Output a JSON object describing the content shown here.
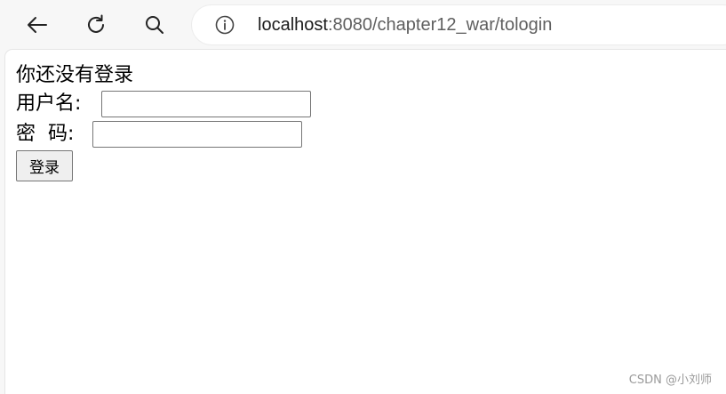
{
  "browser": {
    "url_host": "localhost",
    "url_rest": ":8080/chapter12_war/tologin",
    "icons": [
      "back-arrow-icon",
      "reload-icon",
      "search-icon",
      "info-icon"
    ]
  },
  "page": {
    "heading": "你还没有登录",
    "username_label": "用户名:",
    "username_value": "",
    "password_label": "密  码:",
    "password_value": "",
    "login_button": "登录"
  },
  "watermark": "CSDN @小刘师",
  "colors": {
    "toolbar_bg": "#f7f7f7",
    "content_bg": "#ffffff",
    "url_host": "#1b1b1b",
    "url_path": "#5f5f5f",
    "button_bg": "#efefef",
    "watermark": "#9a9a9a"
  }
}
